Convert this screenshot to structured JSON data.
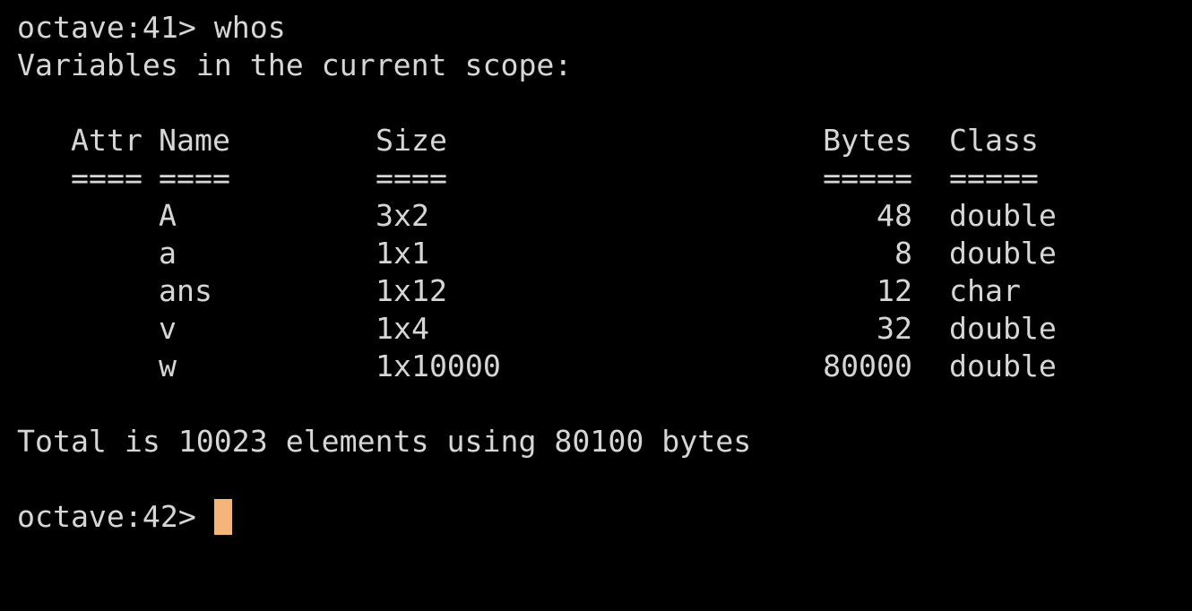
{
  "terminal": {
    "prompt1": "octave:41> ",
    "command1": "whos",
    "scope_header": "Variables in the current scope:",
    "columns": {
      "attr": "Attr",
      "name": "Name",
      "size": "Size",
      "bytes": "Bytes",
      "class": "Class"
    },
    "underlines": {
      "attr": "====",
      "name": "====",
      "size": "====",
      "bytes": "=====",
      "class": "====="
    },
    "rows": [
      {
        "attr": "",
        "name": "A",
        "size": "3x2",
        "bytes": "48",
        "class": "double"
      },
      {
        "attr": "",
        "name": "a",
        "size": "1x1",
        "bytes": "8",
        "class": "double"
      },
      {
        "attr": "",
        "name": "ans",
        "size": "1x12",
        "bytes": "12",
        "class": "char"
      },
      {
        "attr": "",
        "name": "v",
        "size": "1x4",
        "bytes": "32",
        "class": "double"
      },
      {
        "attr": "",
        "name": "w",
        "size": "1x10000",
        "bytes": "80000",
        "class": "double"
      }
    ],
    "total": "Total is 10023 elements using 80100 bytes",
    "prompt2": "octave:42> ",
    "colors": {
      "background": "#000000",
      "foreground": "#d6d6d6",
      "cursor": "#f5b47a"
    }
  }
}
